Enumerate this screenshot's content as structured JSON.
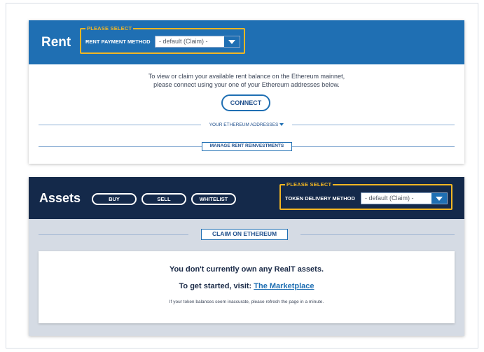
{
  "rent": {
    "title": "Rent",
    "select_legend": "PLEASE SELECT",
    "select_label": "RENT PAYMENT METHOD",
    "select_value": "- default (Claim) -",
    "body_line1": "To view or claim your available rent balance on the Ethereum mainnet,",
    "body_line2": "please connect using your one of your Ethereum addresses below.",
    "connect_label": "CONNECT",
    "addresses_label": "YOUR ETHEREUM ADDRESSES",
    "manage_label": "MANAGE RENT REINVESTMENTS"
  },
  "assets": {
    "title": "Assets",
    "buttons": [
      "BUY",
      "SELL",
      "WHITELIST"
    ],
    "select_legend": "PLEASE SELECT",
    "select_label": "TOKEN DELIVERY METHOD",
    "select_value": "- default (Claim) -",
    "claim_label": "CLAIM ON ETHEREUM",
    "empty_line1": "You don't currently own any RealT assets.",
    "empty_line2_prefix": "To get started, visit: ",
    "empty_line2_link": "The Marketplace",
    "empty_line3": "If your token balances seem inaccurate, please refresh the page in a minute."
  },
  "colors": {
    "rent_header": "#1f6fb3",
    "assets_header": "#14294a",
    "accent_yellow": "#f2b623",
    "link_blue": "#1f6fb3"
  },
  "icons": {
    "dropdown": "chevron-down-icon",
    "addresses_caret": "caret-down-icon"
  }
}
